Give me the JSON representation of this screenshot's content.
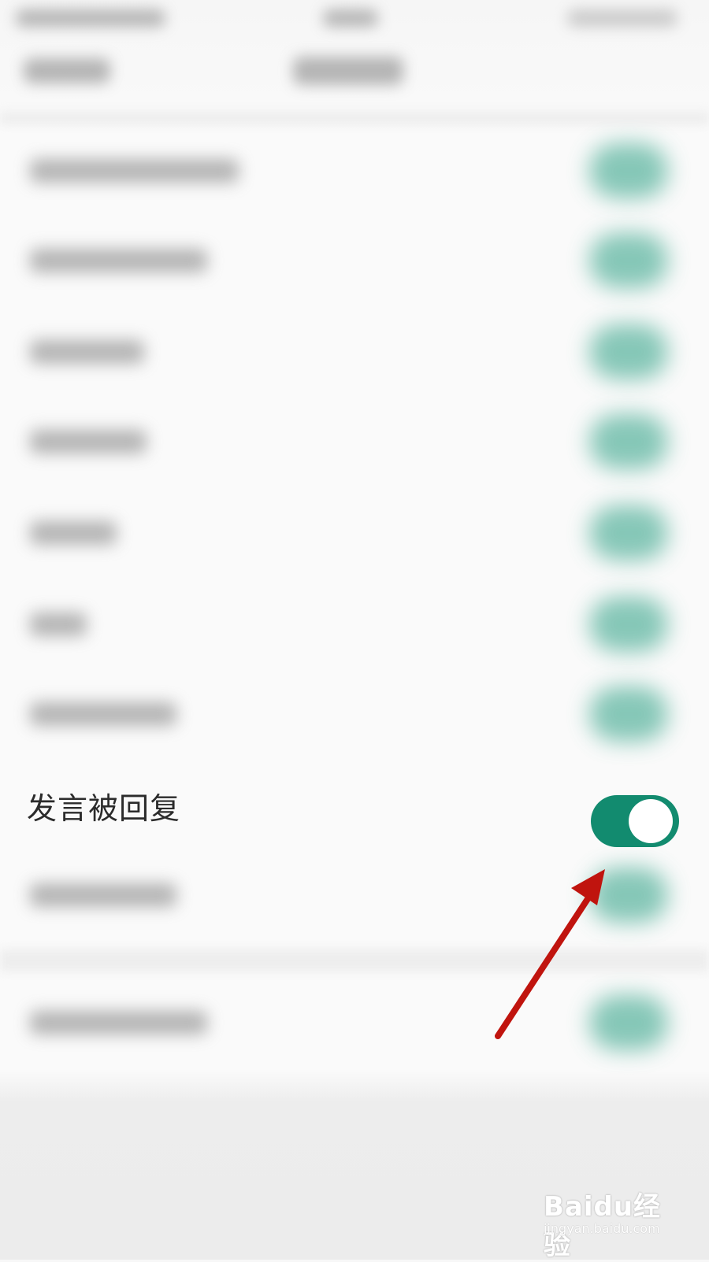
{
  "setting": {
    "label": "发言被回复",
    "enabled": true
  },
  "colors": {
    "toggle_on": "#128b6f",
    "arrow": "#c0140e"
  },
  "watermark": {
    "brand": "Baidu经验",
    "url": "jingyan.baidu.com"
  }
}
